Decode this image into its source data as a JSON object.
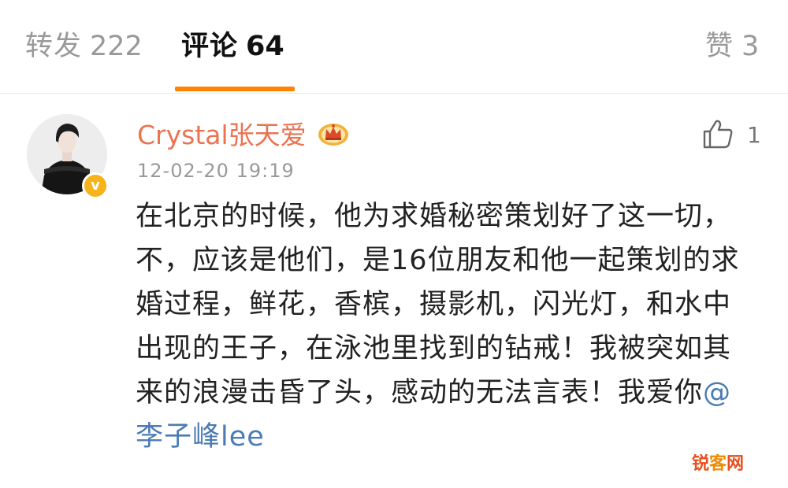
{
  "tabs": {
    "repost": {
      "label": "转发",
      "count": "222"
    },
    "comment": {
      "label": "评论",
      "count": "64"
    },
    "like": {
      "label": "赞",
      "count": "3"
    }
  },
  "comment": {
    "username": "Crystal张天爱",
    "timestamp": "12-02-20 19:19",
    "like_count": "1",
    "text_main": "在北京的时候，他为求婚秘密策划好了这一切，不，应该是他们，是16位朋友和他一起策划的求婚过程，鲜花，香槟，摄影机，闪光灯，和水中出现的王子，在泳池里找到的钻戒！我被突如其来的浪漫击昏了头，感动的无法言表！我爱你",
    "mention": "@李子峰lee",
    "verified_mark": "v",
    "icons": {
      "user_badge": "crown-icon",
      "verified": "verified-badge-icon",
      "like": "thumb-up-icon"
    }
  },
  "colors": {
    "accent": "#ff8200",
    "username": "#eb7350",
    "mention": "#4a7bb5",
    "verified": "#f6b31a",
    "muted": "#999999"
  },
  "watermark": {
    "part1": "锐",
    "part2": "客",
    "part3": "网"
  }
}
